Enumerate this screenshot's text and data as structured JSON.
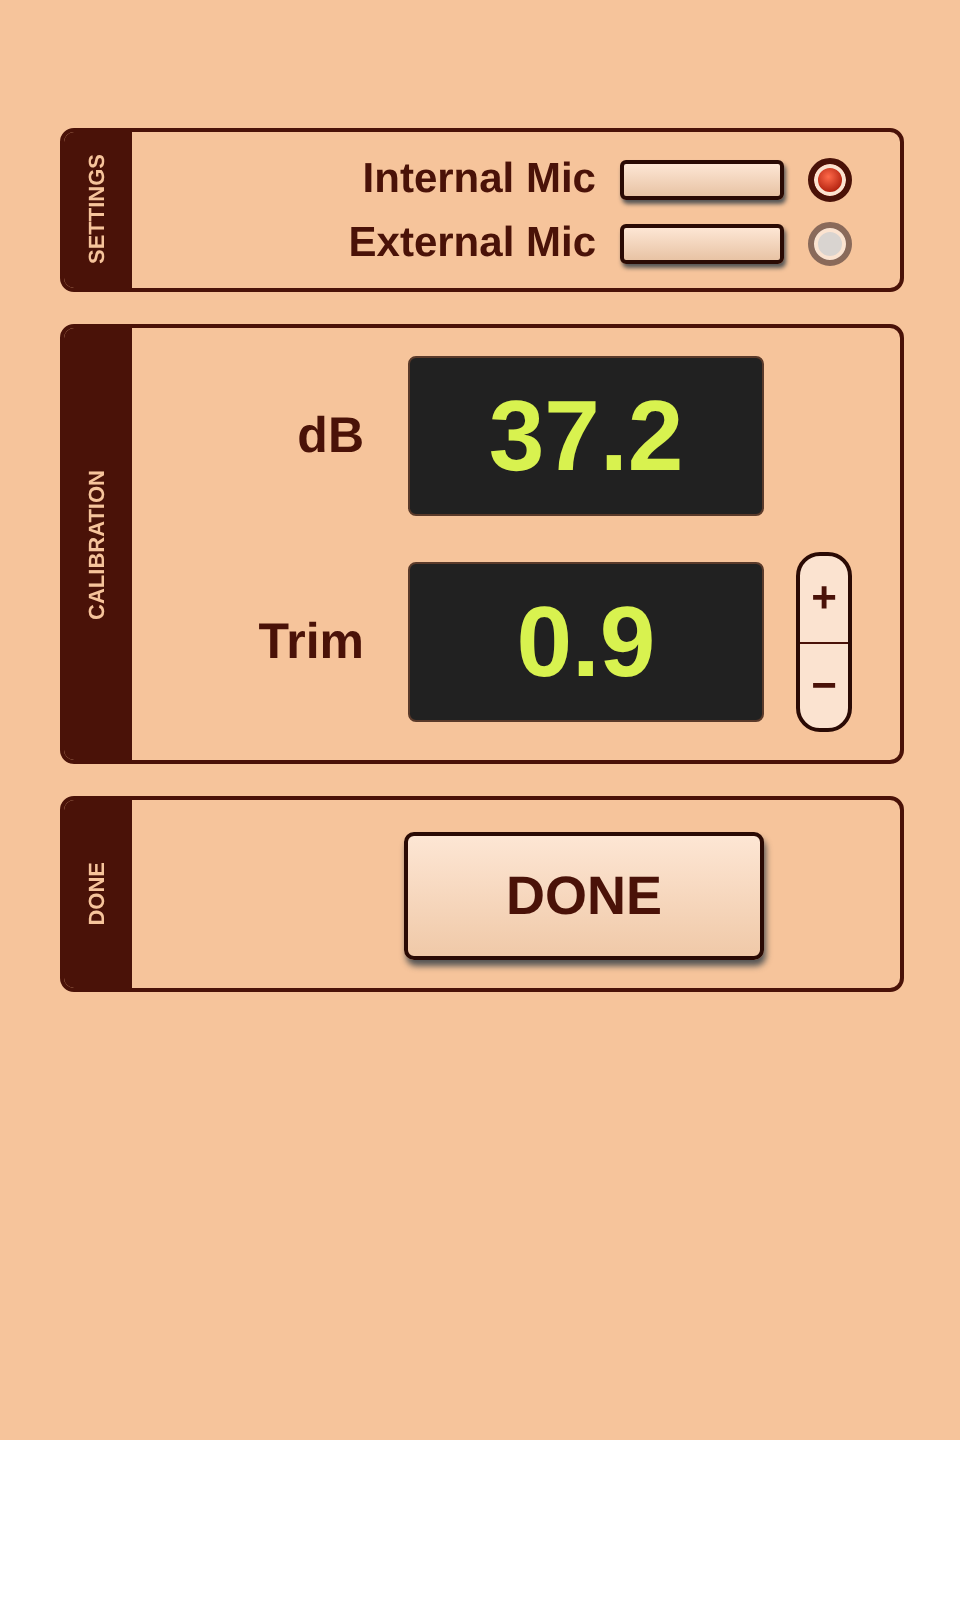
{
  "settings": {
    "label": "SETTINGS",
    "mics": [
      {
        "name": "Internal Mic",
        "selected": true
      },
      {
        "name": "External Mic",
        "selected": false
      }
    ]
  },
  "calibration": {
    "label": "CALIBRATION",
    "readings": [
      {
        "kind": "display",
        "name": "dB",
        "value": "37.2"
      },
      {
        "kind": "stepper",
        "name": "Trim",
        "value": "0.9",
        "plus": "+",
        "minus": "−"
      }
    ]
  },
  "done": {
    "label": "DONE",
    "button": "DONE"
  }
}
